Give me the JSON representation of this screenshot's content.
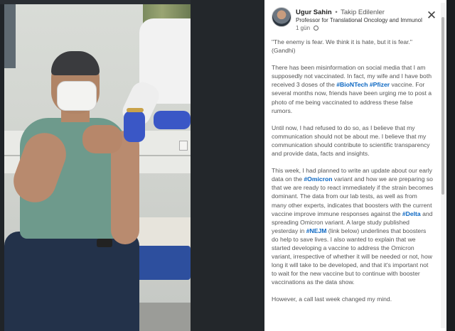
{
  "post": {
    "author": "Ugur Sahin",
    "separator": "•",
    "follow_status": "Takip Edilenler",
    "headline": "Professor for Translational Oncology and Immunol...",
    "time_ago": "1 gün",
    "close_label": "✕",
    "quote_line1": "\"The enemy is fear. We think it is hate, but it is fear.\"",
    "quote_line2": "(Gandhi)",
    "p2_a": "There has been misinformation on social media that I am supposedly not vaccinated. In fact, my wife and I have both received 3 doses of the ",
    "p2_tag1": "#BioNTech",
    "p2_tag2": "#Pfizer",
    "p2_b": " vaccine. For several months now, friends have been urging me to post a photo of me being vaccinated to address these false rumors.",
    "p3": "Until now, I had refused to do so, as I believe that my communication should not be about me. I believe that my communication should contribute to scientific transparency and provide data, facts and insights.",
    "p4_a": "This week, I had planned to write an update about our early data on the ",
    "p4_tag1": "#Omicron",
    "p4_b": " variant and how we are preparing so that we are ready to react immediately if the strain becomes dominant. The data from our lab tests, as well as from many other experts, indicates that boosters with the current vaccine improve immune responses against the ",
    "p4_tag2": "#Delta",
    "p4_c": " and spreading Omicron variant. A large study published yesterday in ",
    "p4_tag3": "#NEJM",
    "p4_d": " (link below) underlines that boosters do help to save lives. I also wanted to explain that we started developing a vaccine to address the Omicron variant, irrespective of whether it will be needed or not, how long it will take to be developed, and that it's important not to wait for the new vaccine but to continue with booster vaccinations as the data show.",
    "p5": "However, a call last week changed my mind."
  },
  "colors": {
    "accent": "#0a66c2",
    "panel_bg": "#ffffff",
    "viewer_bg": "#202428"
  }
}
